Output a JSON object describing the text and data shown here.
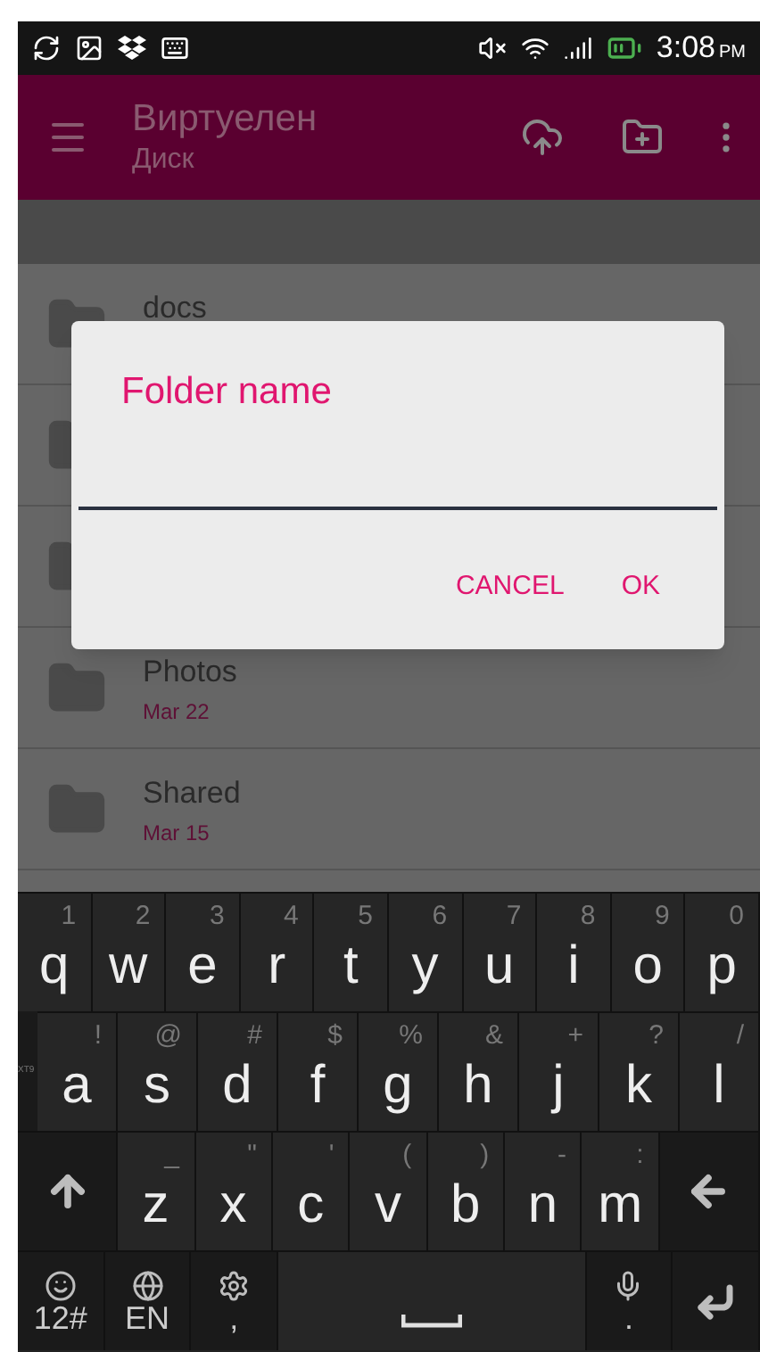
{
  "status_bar": {
    "time": "3:08",
    "meridiem": "PM"
  },
  "app_bar": {
    "title": "Виртуелен",
    "subtitle": "Диск"
  },
  "files": [
    {
      "kind": "folder",
      "name": "docs"
    },
    {
      "kind": "folder"
    },
    {
      "kind": "folder"
    },
    {
      "kind": "folder",
      "name": "Photos",
      "date": "Mar 22"
    },
    {
      "kind": "folder",
      "name": "Shared",
      "date": "Mar 15"
    }
  ],
  "dialog": {
    "title": "Folder name",
    "buttons": [
      "CANCEL",
      "OK"
    ]
  },
  "keyboard": {
    "side_label": "XT9",
    "rows": [
      {
        "keys": [
          {
            "kind": "key",
            "main": "q",
            "hint": "1"
          },
          {
            "kind": "key",
            "main": "w",
            "hint": "2"
          },
          {
            "kind": "key",
            "main": "e",
            "hint": "3"
          },
          {
            "kind": "key",
            "main": "r",
            "hint": "4"
          },
          {
            "kind": "key",
            "main": "t",
            "hint": "5"
          },
          {
            "kind": "key",
            "main": "y",
            "hint": "6"
          },
          {
            "kind": "key",
            "main": "u",
            "hint": "7"
          },
          {
            "kind": "key",
            "main": "i",
            "hint": "8"
          },
          {
            "kind": "key",
            "main": "o",
            "hint": "9"
          },
          {
            "kind": "key",
            "main": "p",
            "hint": "0"
          }
        ]
      },
      {
        "keys": [
          {
            "kind": "key",
            "main": "a",
            "hint": "!"
          },
          {
            "kind": "key",
            "main": "s",
            "hint": "@"
          },
          {
            "kind": "key",
            "main": "d",
            "hint": "#"
          },
          {
            "kind": "key",
            "main": "f",
            "hint": "$"
          },
          {
            "kind": "key",
            "main": "g",
            "hint": "%"
          },
          {
            "kind": "key",
            "main": "h",
            "hint": "&"
          },
          {
            "kind": "key",
            "main": "j",
            "hint": "+"
          },
          {
            "kind": "key",
            "main": "k",
            "hint": "?"
          },
          {
            "kind": "key",
            "main": "l",
            "hint": "/"
          }
        ]
      },
      {
        "keys": [
          {
            "kind": "shift"
          },
          {
            "kind": "key",
            "main": "z",
            "hint": "_"
          },
          {
            "kind": "key",
            "main": "x",
            "hint": "\""
          },
          {
            "kind": "key",
            "main": "c",
            "hint": "'"
          },
          {
            "kind": "key",
            "main": "v",
            "hint": "("
          },
          {
            "kind": "key",
            "main": "b",
            "hint": ")"
          },
          {
            "kind": "key",
            "main": "n",
            "hint": "-"
          },
          {
            "kind": "key",
            "main": "m",
            "hint": ":"
          },
          {
            "kind": "backspace"
          }
        ]
      },
      {
        "keys": [
          {
            "kind": "emoji",
            "main": "12#"
          },
          {
            "kind": "globe",
            "main": "EN"
          },
          {
            "kind": "settings",
            "main": ","
          },
          {
            "kind": "space"
          },
          {
            "kind": "mic",
            "main": "."
          },
          {
            "kind": "enter"
          }
        ]
      }
    ]
  }
}
